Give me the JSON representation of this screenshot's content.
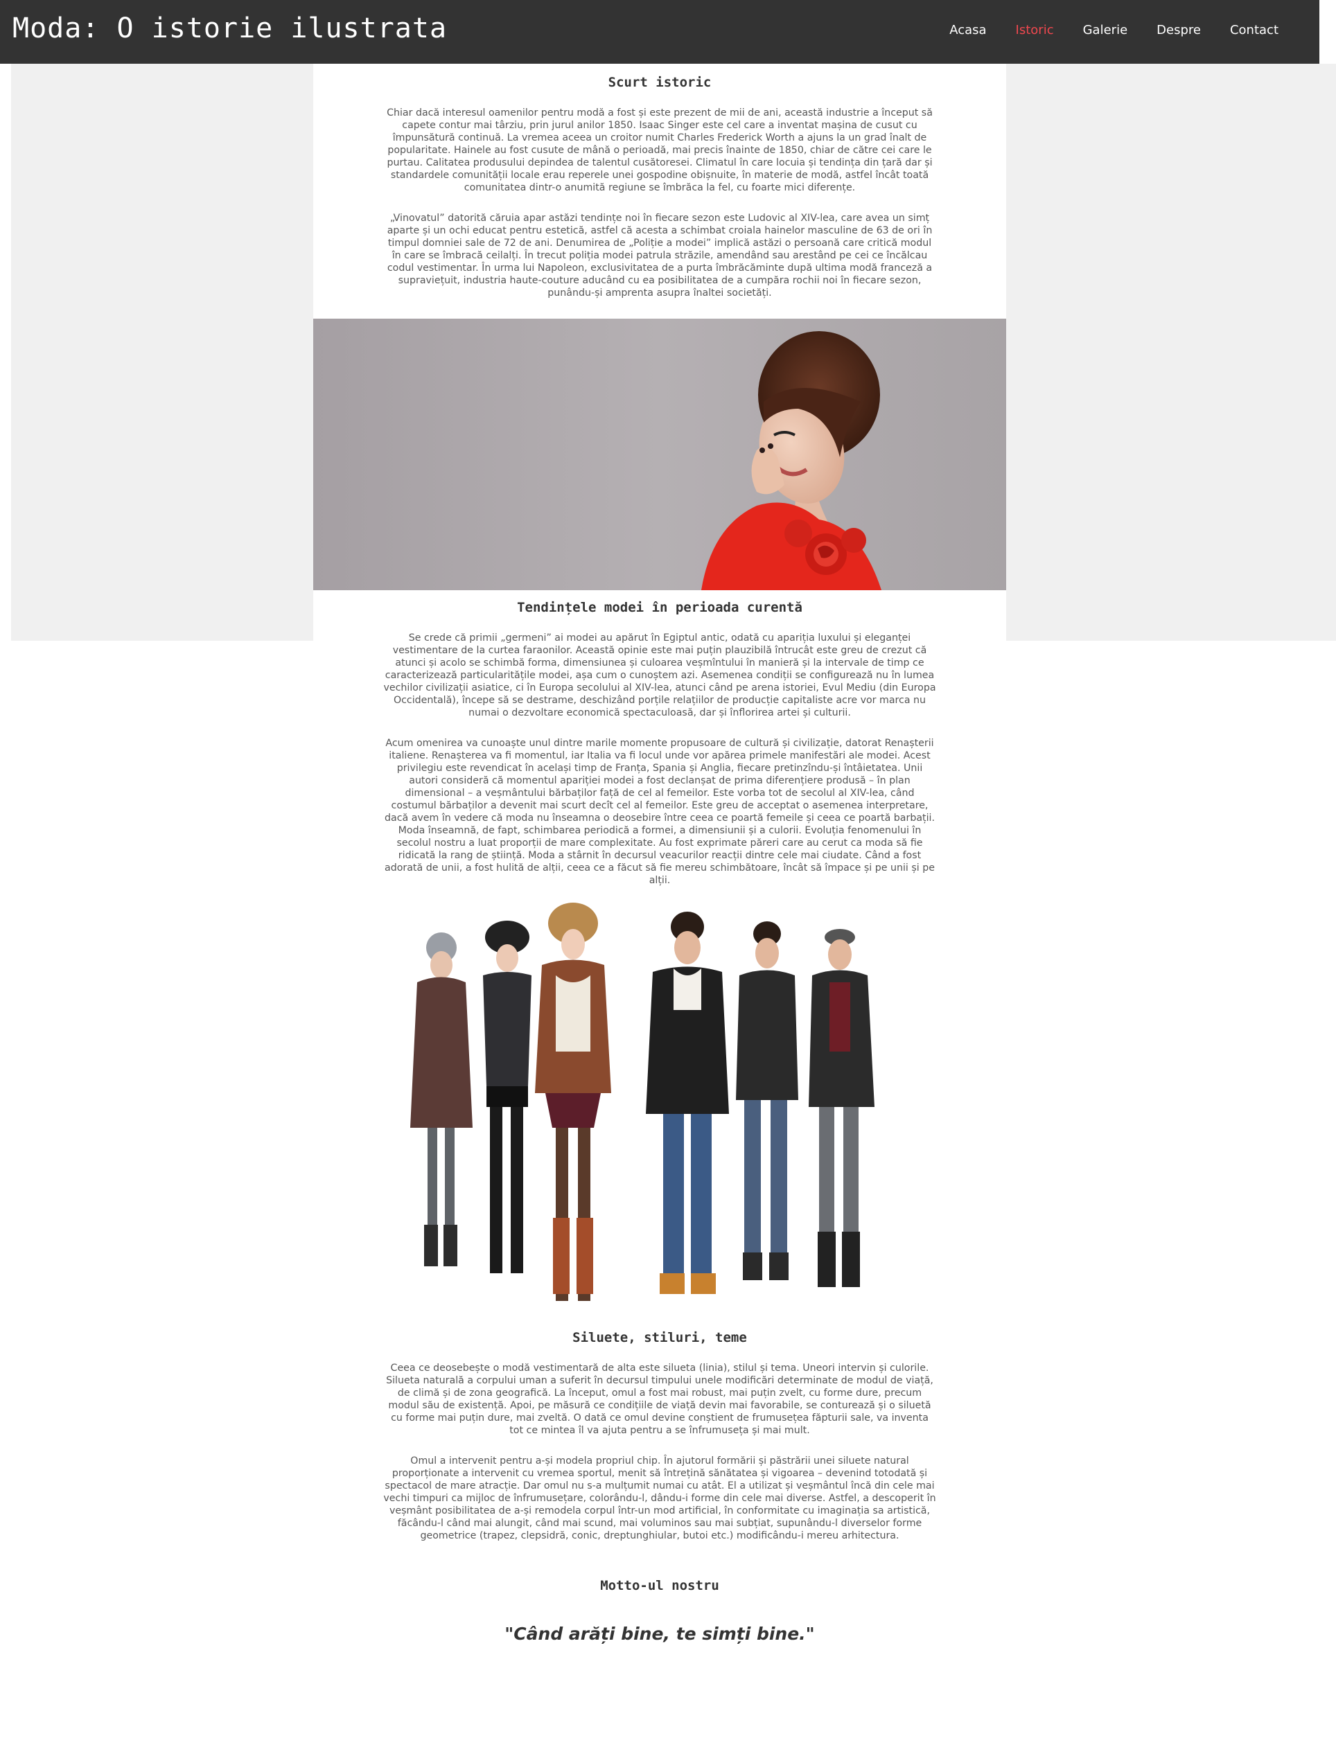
{
  "header": {
    "title": "Moda: O istorie ilustrata",
    "nav": [
      {
        "label": "Acasa",
        "active": false
      },
      {
        "label": "Istoric",
        "active": true
      },
      {
        "label": "Galerie",
        "active": false
      },
      {
        "label": "Despre",
        "active": false
      },
      {
        "label": "Contact",
        "active": false
      }
    ]
  },
  "sections": {
    "istoric": {
      "heading": "Scurt istoric",
      "paragraphs": [
        "Chiar dacă interesul oamenilor pentru modă a fost și este prezent de mii de ani, această industrie a început să capete contur mai târziu, prin jurul anilor 1850. Isaac Singer este cel care a inventat mașina de cusut cu împunsătură continuă. La vremea aceea un croitor numit Charles Frederick Worth a ajuns la un grad înalt de popularitate. Hainele au fost cusute de mână o perioadă, mai precis înainte de 1850, chiar de către cei care le purtau. Calitatea produsului depindea de talentul cusătoresei. Climatul în care locuia și tendința din țară dar și standardele comunității locale erau reperele unei gospodine obișnuite, în materie de modă, astfel încât toată comunitatea dintr-o anumită regiune se îmbrăca la fel, cu foarte mici diferențe.",
        "„Vinovatul” datorită căruia apar astăzi tendințe noi în fiecare sezon este Ludovic al XIV-lea, care avea un simț aparte și un ochi educat pentru estetică, astfel că acesta a schimbat croiala hainelor masculine de 63 de ori în timpul domniei sale de 72 de ani. Denumirea de „Poliție a modei” implică astăzi o persoană care critică modul în care se îmbracă ceilalți. În trecut poliția modei patrula străzile, amendând sau arestând pe cei ce încălcau codul vestimentar. În urma lui Napoleon, exclusivitatea de a purta îmbrăcăminte după ultima modă franceză a supraviețuit, industria haute-couture aducând cu ea posibilitatea de a cumpăra rochii noi în fiecare sezon, punându-și amprenta asupra înaltei societăți."
      ]
    },
    "tendinte": {
      "heading": "Tendințele modei în perioada curentă",
      "paragraphs": [
        "Se crede că primii „germeni” ai modei au apărut în Egiptul antic, odată cu apariția luxului și eleganței vestimentare de la curtea faraonilor. Această opinie este mai puțin plauzibilă întrucât este greu de crezut că atunci și acolo se schimbă forma, dimensiunea și culoarea veșmîntului în manieră și la intervale de timp ce caracterizează particularitățile modei, așa cum o cunoștem azi. Asemenea condiții se configurează nu în lumea vechilor civilizații asiatice, ci în Europa secolului al XIV-lea, atunci când pe arena istoriei, Evul Mediu (din Europa Occidentală), începe să se destrame, deschizând porțile relațiilor de producție capitaliste acre vor marca nu numai o dezvoltare economică spectaculoasă, dar și înflorirea artei și culturii.",
        "Acum omenirea va cunoaște unul dintre marile momente propusoare de cultură și civilizație, datorat Renașterii italiene. Renașterea va fi momentul, iar Italia va fi locul unde vor apărea primele manifestări ale modei. Acest privilegiu este revendicat în același timp de Franța, Spania și Anglia, fiecare pretinzîndu-și întâietatea. Unii autori consideră că momentul apariției modei a fost declanșat de prima diferențiere produsă – în plan dimensional – a veșmântului bărbaților față de cel al femeilor. Este vorba tot de secolul al XIV-lea, când costumul bărbaților a devenit mai scurt decît cel al femeilor. Este greu de acceptat o asemenea interpretare, dacă avem în vedere că moda nu înseamna o deosebire între ceea ce poartă femeile și ceea ce poartă barbații. Moda înseamnă, de fapt, schimbarea periodică a formei, a dimensiunii și a culorii. Evoluția fenomenului în secolul nostru a luat proporții de mare complexitate. Au fost exprimate păreri care au cerut ca moda să fie ridicată la rang de știință. Moda a stârnit în decursul veacurilor reacții dintre cele mai ciudate. Când a fost adorată de unii, a fost hulită de alții, ceea ce a făcut să fie mereu schimbătoare, încât să împace și pe unii și pe alții."
      ]
    },
    "siluete": {
      "heading": "Siluete, stiluri, teme",
      "paragraphs": [
        "Ceea ce deosebește o modă vestimentară de alta este silueta (linia), stilul și tema. Uneori intervin și culorile. Silueta naturală a corpului uman a suferit în decursul timpului unele modificări determinate de modul de viață, de climă și de zona geografică. La început, omul a fost mai robust, mai puțin zvelt, cu forme dure, precum modul său de existență. Apoi, pe măsură ce condițiile de viață devin mai favorabile, se conturează și o siluetă cu forme mai puțin dure, mai zveltă. O dată ce omul devine conștient de frumusețea făpturii sale, va inventa tot ce mintea îl va ajuta pentru a se înfrumuseța și mai mult.",
        "Omul a intervenit pentru a-și modela propriul chip. În ajutorul formării și păstrării unei siluete natural proporționate a intervenit cu vremea sportul, menit să întrețină sănătatea și vigoarea – devenind totodată și spectacol de mare atracție. Dar omul nu s-a mulțumit numai cu atât. El a utilizat și veșmântul încă din cele mai vechi timpuri ca mijloc de înfrumusețare, colorându-l, dându-i forme din cele mai diverse. Astfel, a descoperit în veșmânt posibilitatea de a-și remodela corpul într-un mod artificial, în conformitate cu imaginația sa artistică, făcându-l când mai alungit, când mai scund, mai voluminos sau mai subțiat, supunându-l diverselor forme geometrice (trapez, clepsidră, conic, dreptunghiular, butoi etc.) modificându-i mereu arhitectura."
      ]
    },
    "motto": {
      "heading": "Motto-ul nostru",
      "quote": "\"Când arăți bine, te simți bine.\""
    }
  },
  "colors": {
    "header_bg": "#333333",
    "nav_active": "#f0484f",
    "page_bg_panel": "#f0f0f0",
    "dress_red": "#e4261c"
  }
}
